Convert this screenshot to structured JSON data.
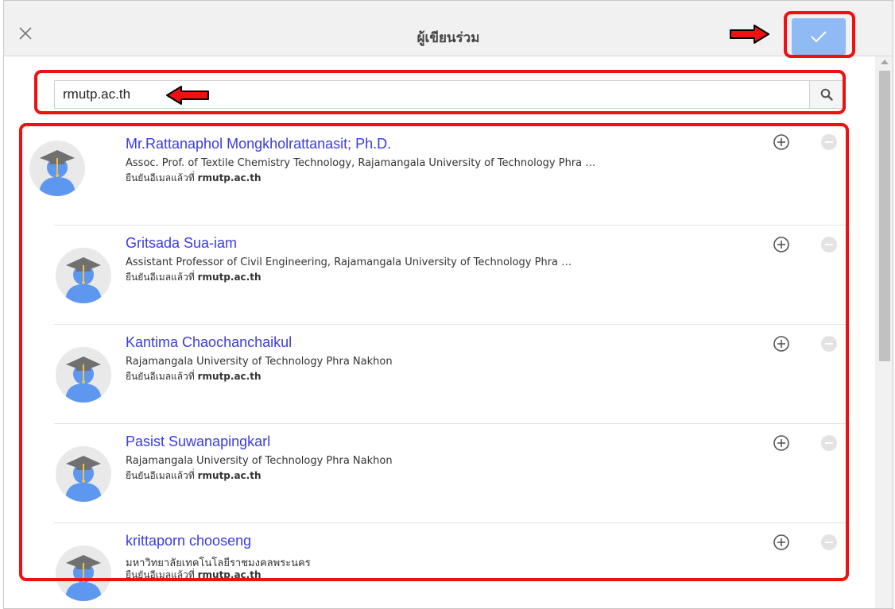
{
  "dialog": {
    "title": "ผู้เขียนร่วม",
    "close_icon": "close-icon",
    "confirm_icon": "checkmark-icon"
  },
  "search": {
    "value": "rmutp.ac.th",
    "icon": "search-icon"
  },
  "colors": {
    "link": "#3b3be0",
    "confirm_button": "#8fbaf3",
    "highlight": "#ee1111"
  },
  "results": [
    {
      "name": "Mr.Rattanaphol Mongkholrattanasit; Ph.D.",
      "affiliation": "Assoc. Prof. of Textile Chemistry Technology, Rajamangala University of Technology Phra …",
      "verified_prefix": "ยืนยันอีเมลแล้วที่",
      "verified_domain": "rmutp.ac.th"
    },
    {
      "name": "Gritsada Sua-iam",
      "affiliation": "Assistant Professor of Civil Engineering, Rajamangala University of Technology Phra …",
      "verified_prefix": "ยืนยันอีเมลแล้วที่",
      "verified_domain": "rmutp.ac.th"
    },
    {
      "name": "Kantima Chaochanchaikul",
      "affiliation": "Rajamangala University of Technology Phra Nakhon",
      "verified_prefix": "ยืนยันอีเมลแล้วที่",
      "verified_domain": "rmutp.ac.th"
    },
    {
      "name": "Pasist Suwanapingkarl",
      "affiliation": "Rajamangala University of Technology Phra Nakhon",
      "verified_prefix": "ยืนยันอีเมลแล้วที่",
      "verified_domain": "rmutp.ac.th"
    },
    {
      "name": "krittaporn chooseng",
      "affiliation": "มหาวิทยาลัยเทคโนโลยีราชมงคลพระนคร",
      "verified_prefix": "ยืนยันอีเมลแล้วที่",
      "verified_domain": "rmutp.ac.th"
    }
  ]
}
